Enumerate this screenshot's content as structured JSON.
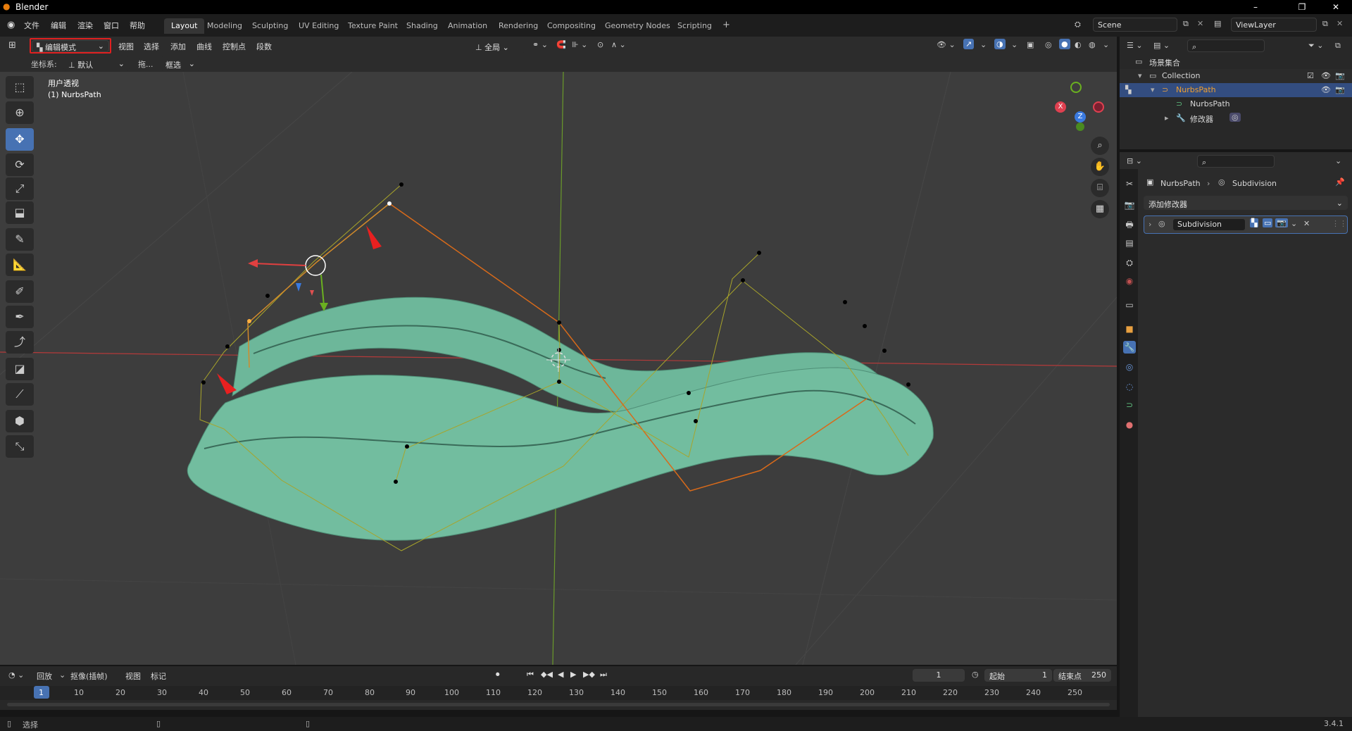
{
  "window": {
    "title": "Blender",
    "minimize": "–",
    "restore": "❐",
    "close": "✕"
  },
  "menubar": [
    "文件",
    "编辑",
    "渲染",
    "窗口",
    "帮助"
  ],
  "workspaces": [
    "Layout",
    "Modeling",
    "Sculpting",
    "UV Editing",
    "Texture Paint",
    "Shading",
    "Animation",
    "Rendering",
    "Compositing",
    "Geometry Nodes",
    "Scripting",
    "+"
  ],
  "active_workspace": "Layout",
  "scene": "Scene",
  "view_layer": "ViewLayer",
  "viewport_header": {
    "mode": "编辑模式",
    "menus": [
      "视图",
      "选择",
      "添加",
      "曲线",
      "控制点",
      "段数"
    ],
    "orientation_label": "全局",
    "coord_label": "坐标系:",
    "coord_value": "默认",
    "drag_label": "拖...",
    "select_value": "框选"
  },
  "viewport": {
    "view_name": "用户透视",
    "object_info": "(1) NurbsPath"
  },
  "gizmo": {
    "x": "X",
    "y": "Y",
    "z": "Z"
  },
  "outliner": {
    "scene_collection": "场景集合",
    "collection": "Collection",
    "object": "NurbsPath",
    "data": "NurbsPath",
    "modifiers": "修改器"
  },
  "properties": {
    "breadcrumb_object": "NurbsPath",
    "breadcrumb_modifier": "Subdivision",
    "add_modifier": "添加修改器",
    "modifier_name": "Subdivision"
  },
  "timeline": {
    "menus": [
      "回放",
      "抠像(插帧)",
      "视图",
      "标记"
    ],
    "current_frame": "1",
    "start_label": "起始",
    "start": "1",
    "end_label": "结束点",
    "end": "250",
    "ruler": [
      "1",
      "10",
      "20",
      "30",
      "40",
      "50",
      "60",
      "70",
      "80",
      "90",
      "100",
      "110",
      "120",
      "130",
      "140",
      "150",
      "160",
      "170",
      "180",
      "190",
      "200",
      "210",
      "220",
      "230",
      "240",
      "250"
    ]
  },
  "status": {
    "select": "选择",
    "version": "3.4.1"
  }
}
